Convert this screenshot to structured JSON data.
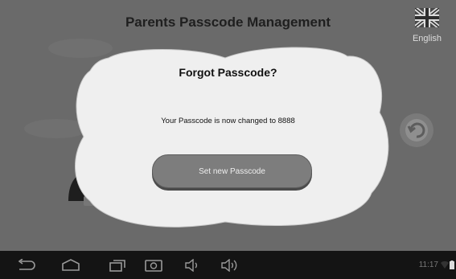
{
  "app": {
    "title": "Parents Passcode Management",
    "language_label": "English"
  },
  "dialog": {
    "title": "Forgot Passcode?",
    "message": "Your Passcode is now changed to 8888",
    "button_label": "Set new Passcode"
  },
  "status_bar": {
    "time": "11:17"
  },
  "icons": [
    "uk-flag-icon",
    "back-circle-icon",
    "lock-icon",
    "back-nav-icon",
    "home-nav-icon",
    "recent-apps-icon",
    "screenshot-icon",
    "volume-down-icon",
    "volume-up-icon",
    "wifi-icon",
    "battery-icon"
  ]
}
